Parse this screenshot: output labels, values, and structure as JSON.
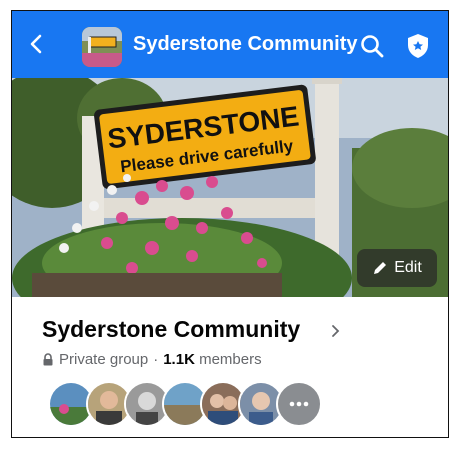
{
  "header": {
    "back_icon": "chevron-left-icon",
    "title": "Syderstone Community",
    "search_icon": "search-icon",
    "shield_icon": "shield-icon",
    "bar_color": "#1877f2"
  },
  "cover": {
    "sign_line1": "SYDERSTONE",
    "sign_line2": "Please drive carefully",
    "edit_label": "Edit"
  },
  "group": {
    "name": "Syderstone Community",
    "privacy": "Private group",
    "separator": "·",
    "member_count": "1.1K",
    "members_label": "members"
  },
  "members": {
    "more_icon": "more-dots-icon",
    "avatar_count_visible": 7
  }
}
